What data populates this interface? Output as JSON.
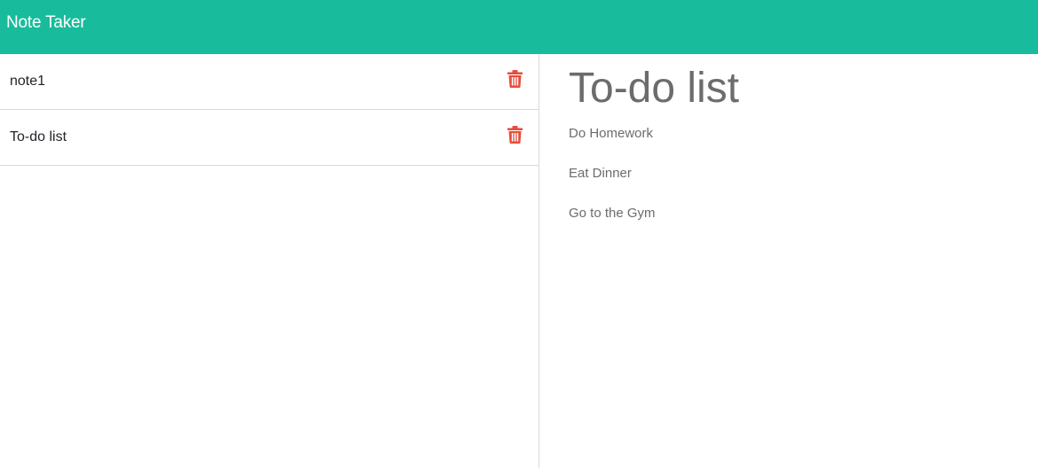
{
  "navbar": {
    "brand": "Note Taker",
    "color": "#18bc9c"
  },
  "notes": [
    {
      "title": "note1",
      "delete_icon": "trash-icon"
    },
    {
      "title": "To-do list",
      "delete_icon": "trash-icon"
    }
  ],
  "active_note": {
    "title": "To-do list",
    "lines": [
      "Do Homework",
      "Eat Dinner",
      "Go to the Gym"
    ]
  },
  "colors": {
    "delete": "#e74c3c",
    "muted_text": "#6c6c6c"
  }
}
